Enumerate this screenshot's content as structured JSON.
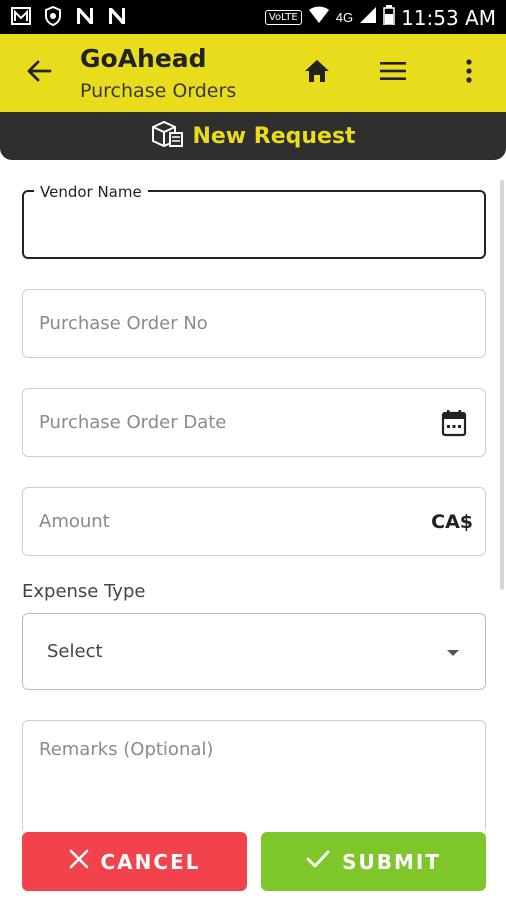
{
  "status_bar": {
    "network_label": "4G",
    "volte_label": "VoLTE",
    "time": "11:53 AM"
  },
  "app_bar": {
    "title": "GoAhead",
    "subtitle": "Purchase Orders"
  },
  "section": {
    "title": "New Request"
  },
  "form": {
    "vendor_name": {
      "label": "Vendor Name",
      "value": ""
    },
    "po_no": {
      "placeholder": "Purchase Order No"
    },
    "po_date": {
      "placeholder": "Purchase Order Date"
    },
    "amount": {
      "placeholder": "Amount",
      "currency": "CA$"
    },
    "expense_type": {
      "label": "Expense Type",
      "selected": "Select"
    },
    "remarks": {
      "placeholder": "Remarks (Optional)"
    }
  },
  "buttons": {
    "cancel_label": "CANCEL",
    "submit_label": "SUBMIT"
  },
  "colors": {
    "accent": "#e8dc1c",
    "header_dark": "#2f2f2f",
    "cancel": "#f2434d",
    "submit": "#7fc62b"
  }
}
